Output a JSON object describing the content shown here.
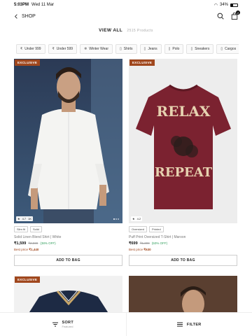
{
  "status": {
    "time": "5:03PM",
    "date": "Wed 11 Mar",
    "battery": "34%"
  },
  "header": {
    "back_label": "SHOP",
    "bag_count": "2"
  },
  "listing": {
    "title": "VIEW ALL",
    "count": "2515 Products"
  },
  "chips": [
    {
      "icon": "₹",
      "label": "Under 999"
    },
    {
      "icon": "₹",
      "label": "Under 599"
    },
    {
      "icon": "❄",
      "label": "Winter Wear"
    },
    {
      "icon": "▯",
      "label": "Shirts"
    },
    {
      "icon": "▯",
      "label": "Jeans"
    },
    {
      "icon": "▯",
      "label": "Polo"
    },
    {
      "icon": "▯",
      "label": "Sneakers"
    },
    {
      "icon": "▯",
      "label": "Cargos"
    }
  ],
  "products": [
    {
      "badge": "EXCLUSIVE",
      "rating": "4.7",
      "reviews": "1K",
      "tags": [
        "Slim fit",
        "Solid"
      ],
      "name": "Solid Linen Blend Shirt | White",
      "price": "₹1,599",
      "mrp": "₹2,599",
      "off": "(38% OFF)",
      "best_label": "Best price",
      "best_price": "₹1,440",
      "cta": "ADD TO BAG"
    },
    {
      "badge": "EXCLUSIVE",
      "rating": "4.2",
      "reviews": "",
      "tags": [
        "Oversized",
        "Printed"
      ],
      "name": "Puff Print Oversized T-Shirt | Maroon",
      "price": "₹699",
      "mrp": "₹1,399",
      "off": "(50% OFF)",
      "best_label": "Best price",
      "best_price": "₹630",
      "cta": "ADD TO BAG"
    }
  ],
  "row2": [
    {
      "badge": "EXCLUSIVE"
    },
    {
      "badge": ""
    }
  ],
  "tshirt_print": {
    "top": "RELAX",
    "bottom": "REPEAT"
  },
  "bottombar": {
    "sort_label": "SORT",
    "sort_sub": "Featured",
    "filter_label": "FILTER"
  },
  "colors": {
    "accent": "#a0471d",
    "discount": "#2f9e5b",
    "maroon": "#7b2230"
  }
}
